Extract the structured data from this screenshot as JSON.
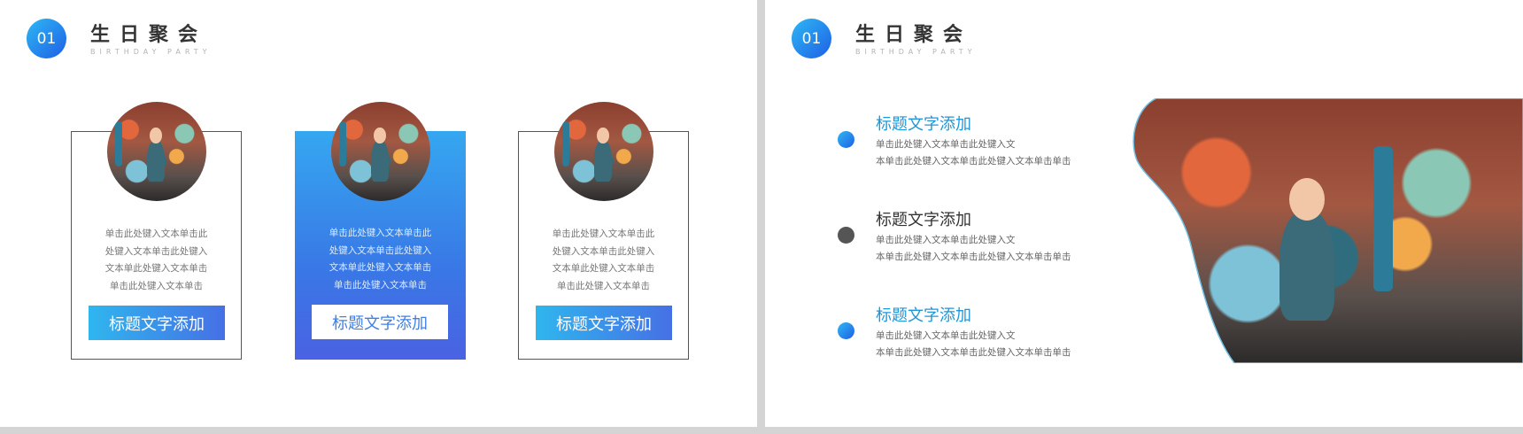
{
  "colors": {
    "accent_start": "#2fb8f3",
    "accent_end": "#1e5fe6",
    "gray_dot": "#555555",
    "title_blue": "#1f96d8"
  },
  "left_slide": {
    "badge": "01",
    "title": "生日聚会",
    "subtitle": "BIRTHDAY PARTY",
    "cards": [
      {
        "text": [
          "单击此处键入文本单击此",
          "处键入文本单击此处键入",
          "文本单此处键入文本单击",
          "单击此处键入文本单击"
        ],
        "button": "标题文字添加"
      },
      {
        "text": [
          "单击此处键入文本单击此",
          "处键入文本单击此处键入",
          "文本单此处键入文本单击",
          "单击此处键入文本单击"
        ],
        "button": "标题文字添加"
      },
      {
        "text": [
          "单击此处键入文本单击此",
          "处键入文本单击此处键入",
          "文本单此处键入文本单击",
          "单击此处键入文本单击"
        ],
        "button": "标题文字添加"
      }
    ]
  },
  "right_slide": {
    "badge": "01",
    "title": "生日聚会",
    "subtitle": "BIRTHDAY PARTY",
    "items": [
      {
        "title": "标题文字添加",
        "line1": "单击此处键入文本单击此处键入文",
        "line2": "本单击此处键入文本单击此处键入文本单击单击",
        "dot": "blue"
      },
      {
        "title": "标题文字添加",
        "line1": "单击此处键入文本单击此处键入文",
        "line2": "本单击此处键入文本单击此处键入文本单击单击",
        "dot": "gray"
      },
      {
        "title": "标题文字添加",
        "line1": "单击此处键入文本单击此处键入文",
        "line2": "本单击此处键入文本单击此处键入文本单击单击",
        "dot": "blue"
      }
    ]
  }
}
